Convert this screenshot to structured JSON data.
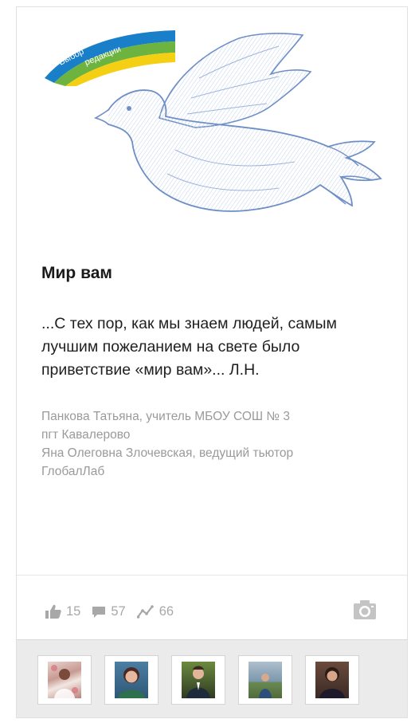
{
  "card": {
    "badge": {
      "line1": "Выбор",
      "line2": "редакции"
    },
    "title": "Мир вам",
    "excerpt": "...С тех пор, как мы знаем людей, самым лучшим пожеланием на свете было приветствие «мир вам»... Л.Н.",
    "authors": [
      "Панкова Татьяна, учитель МБОУ СОШ № 3",
      "пгт Кавалерово",
      "Яна Олеговна Злочевская, ведущий тьютор",
      "ГлобалЛаб"
    ],
    "stats": {
      "likes": "15",
      "comments": "57",
      "views": "66"
    },
    "icons": {
      "likes": "thumbs-up-icon",
      "comments": "comment-icon",
      "views": "activity-icon",
      "media": "camera-icon"
    },
    "colors": {
      "stat_gray": "#a8a8a8",
      "ribbon_blue": "#1a7fc9",
      "ribbon_green": "#6cb33f",
      "ribbon_yellow": "#f4cf14",
      "dove_outline": "#6e8fc6"
    },
    "participants": [
      {
        "name": "participant-1",
        "bg": "#c9a9a3"
      },
      {
        "name": "participant-2",
        "bg": "#3d6b8c"
      },
      {
        "name": "participant-3",
        "bg": "#3b4a2c"
      },
      {
        "name": "participant-4",
        "bg": "#6f8aa3"
      },
      {
        "name": "participant-5",
        "bg": "#5a3d33"
      }
    ]
  }
}
